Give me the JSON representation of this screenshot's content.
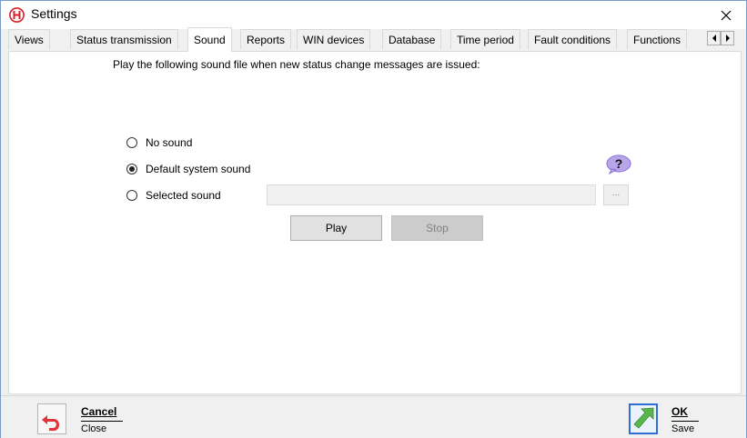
{
  "window": {
    "title": "Settings"
  },
  "tabs": [
    {
      "label": "Views",
      "active": false
    },
    {
      "label": "Status transmission",
      "active": false
    },
    {
      "label": "Sound",
      "active": true
    },
    {
      "label": "Reports",
      "active": false
    },
    {
      "label": "WIN devices",
      "active": false
    },
    {
      "label": "Database",
      "active": false
    },
    {
      "label": "Time period",
      "active": false
    },
    {
      "label": "Fault conditions",
      "active": false
    },
    {
      "label": "Functions",
      "active": false
    }
  ],
  "sound": {
    "prompt": "Play the following sound file when new status change messages are issued:",
    "options": [
      {
        "label": "No sound",
        "checked": false
      },
      {
        "label": "Default system sound",
        "checked": true
      },
      {
        "label": "Selected sound",
        "checked": false
      }
    ],
    "selected_file_value": "",
    "browse_label": "...",
    "play_label": "Play",
    "stop_label": "Stop",
    "help_symbol": "?"
  },
  "footer": {
    "cancel_label": "Cancel",
    "cancel_sub": "Close",
    "ok_label": "OK",
    "ok_sub": "Save"
  },
  "colors": {
    "app_red": "#d8202a",
    "help_purple": "#b9a6ea",
    "ok_green": "#59b64a",
    "ok_border": "#2f6fd3",
    "cancel_red": "#e0343b"
  },
  "icons": {
    "app": "app-logo-icon",
    "close": "close-icon",
    "tab_left": "scroll-left-icon",
    "tab_right": "scroll-right-icon",
    "help": "help-bubble-icon",
    "cancel": "undo-arrow-icon",
    "ok": "ok-arrow-icon"
  }
}
